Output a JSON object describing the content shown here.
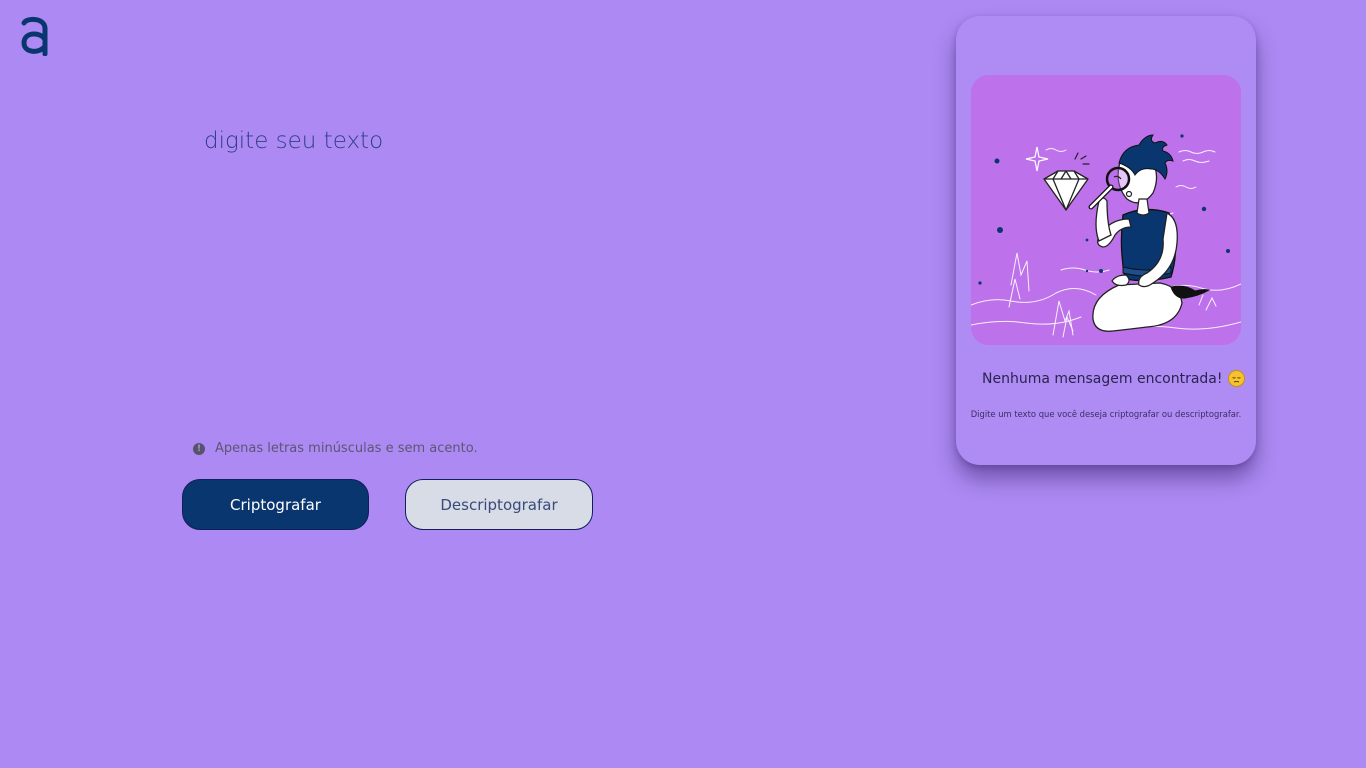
{
  "logo": {
    "icon": "alura-a-logo-icon",
    "color": "#0a3670"
  },
  "input": {
    "placeholder": "digite seu texto",
    "value": ""
  },
  "hint": {
    "icon": "info-icon",
    "text": "Apenas letras minúsculas e sem acento."
  },
  "buttons": {
    "encrypt_label": "Criptografar",
    "decrypt_label": "Descriptografar"
  },
  "output": {
    "illustration": "person-with-magnifying-glass-and-diamond-illustration",
    "title": "Nenhuma mensagem encontrada!",
    "emoji": "sad-face-emoji-icon",
    "subtitle": "Digite um texto que você deseja criptografar ou descriptografar."
  },
  "colors": {
    "background": "#ad8af3",
    "primary": "#0a3670",
    "secondary": "#d7dce6",
    "illustration_bg": "#bd71ea"
  }
}
